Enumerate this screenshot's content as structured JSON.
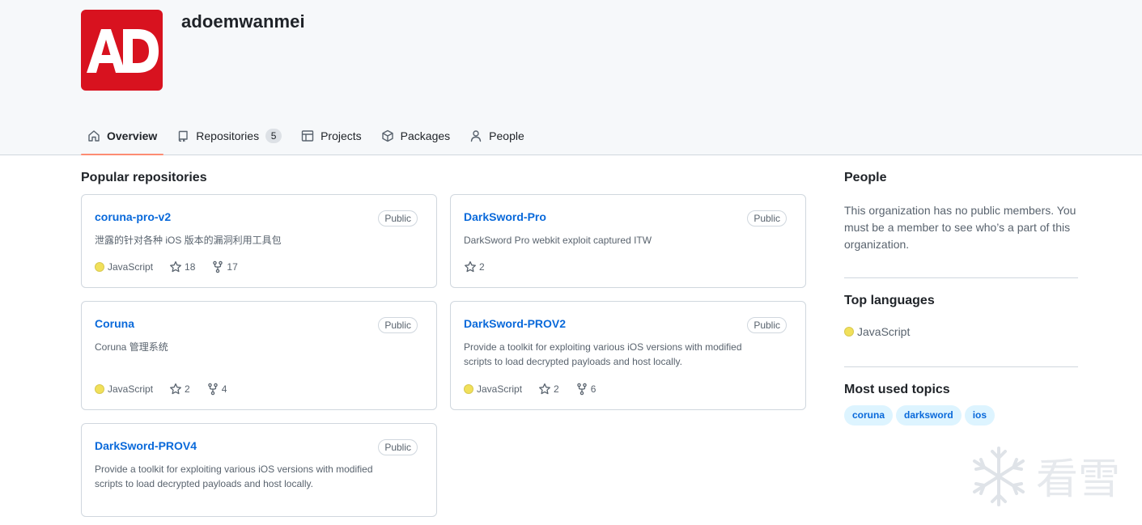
{
  "colors": {
    "accent": "#0969da",
    "tab_underline": "#fd8c73",
    "javascript": "#f1e05a",
    "avatar_bg": "#d8121f"
  },
  "org": {
    "avatar_text": "AD",
    "name": "adoemwanmei"
  },
  "tabs": [
    {
      "label": "Overview",
      "icon": "home-icon"
    },
    {
      "label": "Repositories",
      "icon": "repo-icon",
      "count": "5"
    },
    {
      "label": "Projects",
      "icon": "table-icon"
    },
    {
      "label": "Packages",
      "icon": "package-icon"
    },
    {
      "label": "People",
      "icon": "person-icon"
    }
  ],
  "popular": {
    "title": "Popular repositories",
    "repos": [
      {
        "name": "coruna-pro-v2",
        "visibility": "Public",
        "description": "泄露的针对各种 iOS 版本的漏洞利用工具包",
        "language": "JavaScript",
        "stars": "18",
        "forks": "17"
      },
      {
        "name": "DarkSword-Pro",
        "visibility": "Public",
        "description": "DarkSword Pro webkit exploit captured ITW",
        "stars": "2"
      },
      {
        "name": "Coruna",
        "visibility": "Public",
        "description": "Coruna 管理系统",
        "language": "JavaScript",
        "stars": "2",
        "forks": "4"
      },
      {
        "name": "DarkSword-PROV2",
        "visibility": "Public",
        "description": "Provide a toolkit for exploiting various iOS versions with modified scripts to load decrypted payloads and host locally.",
        "language": "JavaScript",
        "stars": "2",
        "forks": "6"
      },
      {
        "name": "DarkSword-PROV4",
        "visibility": "Public",
        "description": "Provide a toolkit for exploiting various iOS versions with modified scripts to load decrypted payloads and host locally."
      }
    ]
  },
  "sidebar": {
    "people_title": "People",
    "people_text": "This organization has no public members. You must be a member to see who’s a part of this organization.",
    "languages_title": "Top languages",
    "top_language": "JavaScript",
    "topics_title": "Most used topics",
    "topics": [
      "coruna",
      "darksword",
      "ios"
    ]
  },
  "watermark": {
    "text": "看雪"
  }
}
